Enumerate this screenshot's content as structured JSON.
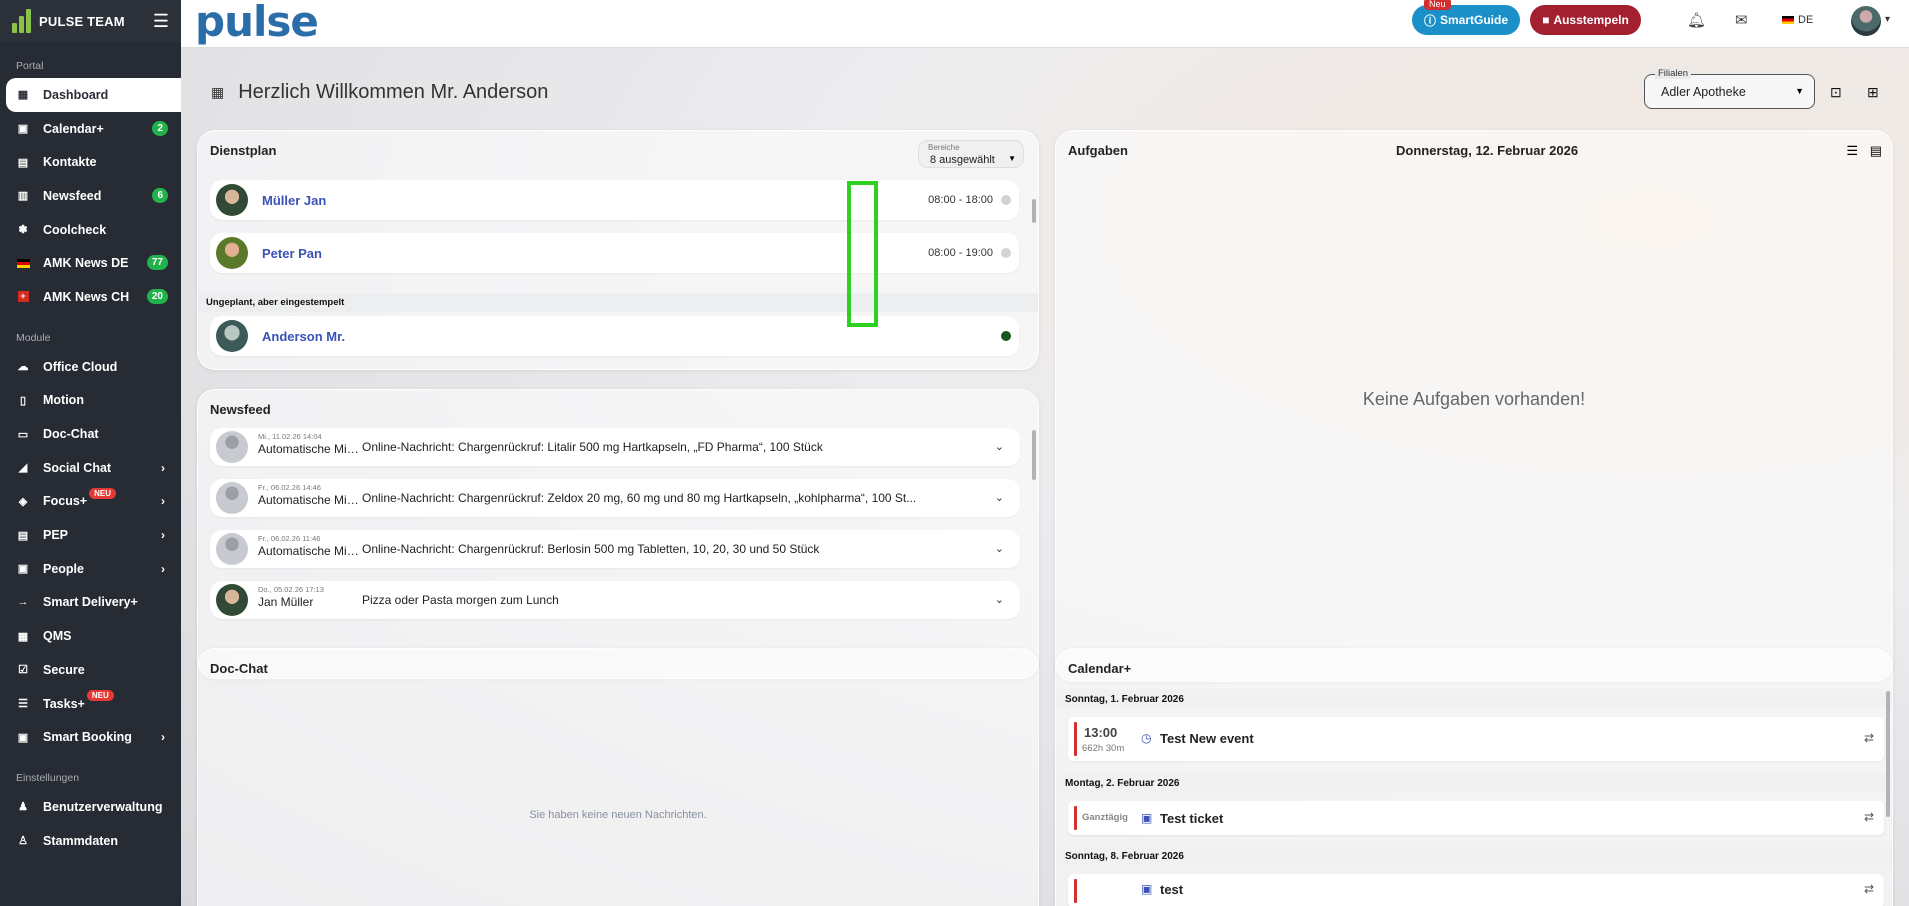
{
  "sidebar": {
    "team": "PULSE TEAM",
    "sections": {
      "portal": "Portal",
      "module": "Module",
      "settings": "Einstellungen"
    },
    "portal_items": [
      {
        "label": "Dashboard",
        "icon": "dashboard-icon"
      },
      {
        "label": "Calendar+",
        "icon": "calendar-icon",
        "badge": "2"
      },
      {
        "label": "Kontakte",
        "icon": "contacts-icon"
      },
      {
        "label": "Newsfeed",
        "icon": "newsfeed-icon",
        "badge": "6"
      },
      {
        "label": "Coolcheck",
        "icon": "snowflake-icon"
      },
      {
        "label": "AMK News DE",
        "icon": "flag-de-icon",
        "badge": "77"
      },
      {
        "label": "AMK News CH",
        "icon": "flag-ch-icon",
        "badge": "20"
      }
    ],
    "module_items": [
      {
        "label": "Office Cloud",
        "icon": "cloud-icon"
      },
      {
        "label": "Motion",
        "icon": "motion-icon"
      },
      {
        "label": "Doc-Chat",
        "icon": "chat-icon"
      },
      {
        "label": "Social Chat",
        "icon": "megaphone-icon"
      },
      {
        "label": "Focus+",
        "icon": "focus-icon",
        "neu": "NEU"
      },
      {
        "label": "PEP",
        "icon": "pep-icon"
      },
      {
        "label": "People",
        "icon": "people-icon"
      },
      {
        "label": "Smart Delivery+",
        "icon": "arrow-icon"
      },
      {
        "label": "QMS",
        "icon": "qms-icon"
      },
      {
        "label": "Secure",
        "icon": "check-icon"
      },
      {
        "label": "Tasks+",
        "icon": "list-icon",
        "neu": "NEU"
      },
      {
        "label": "Smart Booking",
        "icon": "booking-icon"
      }
    ],
    "settings_items": [
      {
        "label": "Benutzerverwaltung",
        "icon": "users-icon"
      },
      {
        "label": "Stammdaten",
        "icon": "user-icon"
      }
    ]
  },
  "topbar": {
    "logo": "pulse",
    "smartguide_new": "Neu",
    "smartguide": "SmartGuide",
    "ausstempeln": "Ausstempeln",
    "lang": "DE"
  },
  "page": {
    "title": "Herzlich Willkommen Mr. Anderson",
    "filial_label": "Filialen",
    "filial_value": "Adler Apotheke"
  },
  "dienstplan": {
    "title": "Dienstplan",
    "filter_label": "Bereiche",
    "filter_value": "8 ausgewählt",
    "rows": [
      {
        "name": "Müller Jan",
        "time": "08:00 - 18:00"
      },
      {
        "name": "Peter Pan",
        "time": "08:00 - 19:00"
      }
    ],
    "unplanned_label": "Ungeplant, aber eingestempelt",
    "unplanned": [
      {
        "name": "Anderson Mr.",
        "time": ""
      }
    ]
  },
  "newsfeed": {
    "title": "Newsfeed",
    "items": [
      {
        "date": "Mi., 11.02.26 14:04",
        "author": "Automatische Mitteilung",
        "text": "Online-Nachricht: Chargenrückruf: Litalir 500 mg Hartkapseln, „FD Pharma“, 100 Stück"
      },
      {
        "date": "Fr., 06.02.26 14:46",
        "author": "Automatische Mitteilung",
        "text": "Online-Nachricht: Chargenrückruf: Zeldox 20 mg, 60 mg und 80 mg Hartkapseln, „kohlpharma“, 100 St..."
      },
      {
        "date": "Fr., 06.02.26 11:46",
        "author": "Automatische Mitteilung",
        "text": "Online-Nachricht: Chargenrückruf: Berlosin 500 mg Tabletten, 10, 20, 30 und 50 Stück"
      },
      {
        "date": "Do., 05.02.26 17:13",
        "author": "Jan Müller",
        "text": "Pizza oder Pasta morgen zum Lunch"
      }
    ]
  },
  "aufgaben": {
    "title": "Aufgaben",
    "date": "Donnerstag, 12. Februar 2026",
    "empty": "Keine Aufgaben vorhanden!"
  },
  "docchat": {
    "title": "Doc-Chat",
    "empty": "Sie haben keine neuen Nachrichten."
  },
  "calendar": {
    "title": "Calendar+",
    "days": [
      {
        "label": "Sonntag, 1. Februar 2026",
        "event": {
          "time": "13:00",
          "duration": "662h 30m",
          "title": "Test New event"
        }
      },
      {
        "label": "Montag, 2. Februar 2026",
        "event": {
          "allday": "Ganztägig",
          "title": "Test ticket"
        }
      },
      {
        "label": "Sonntag, 8. Februar 2026",
        "event": {
          "title": "test"
        }
      }
    ]
  }
}
